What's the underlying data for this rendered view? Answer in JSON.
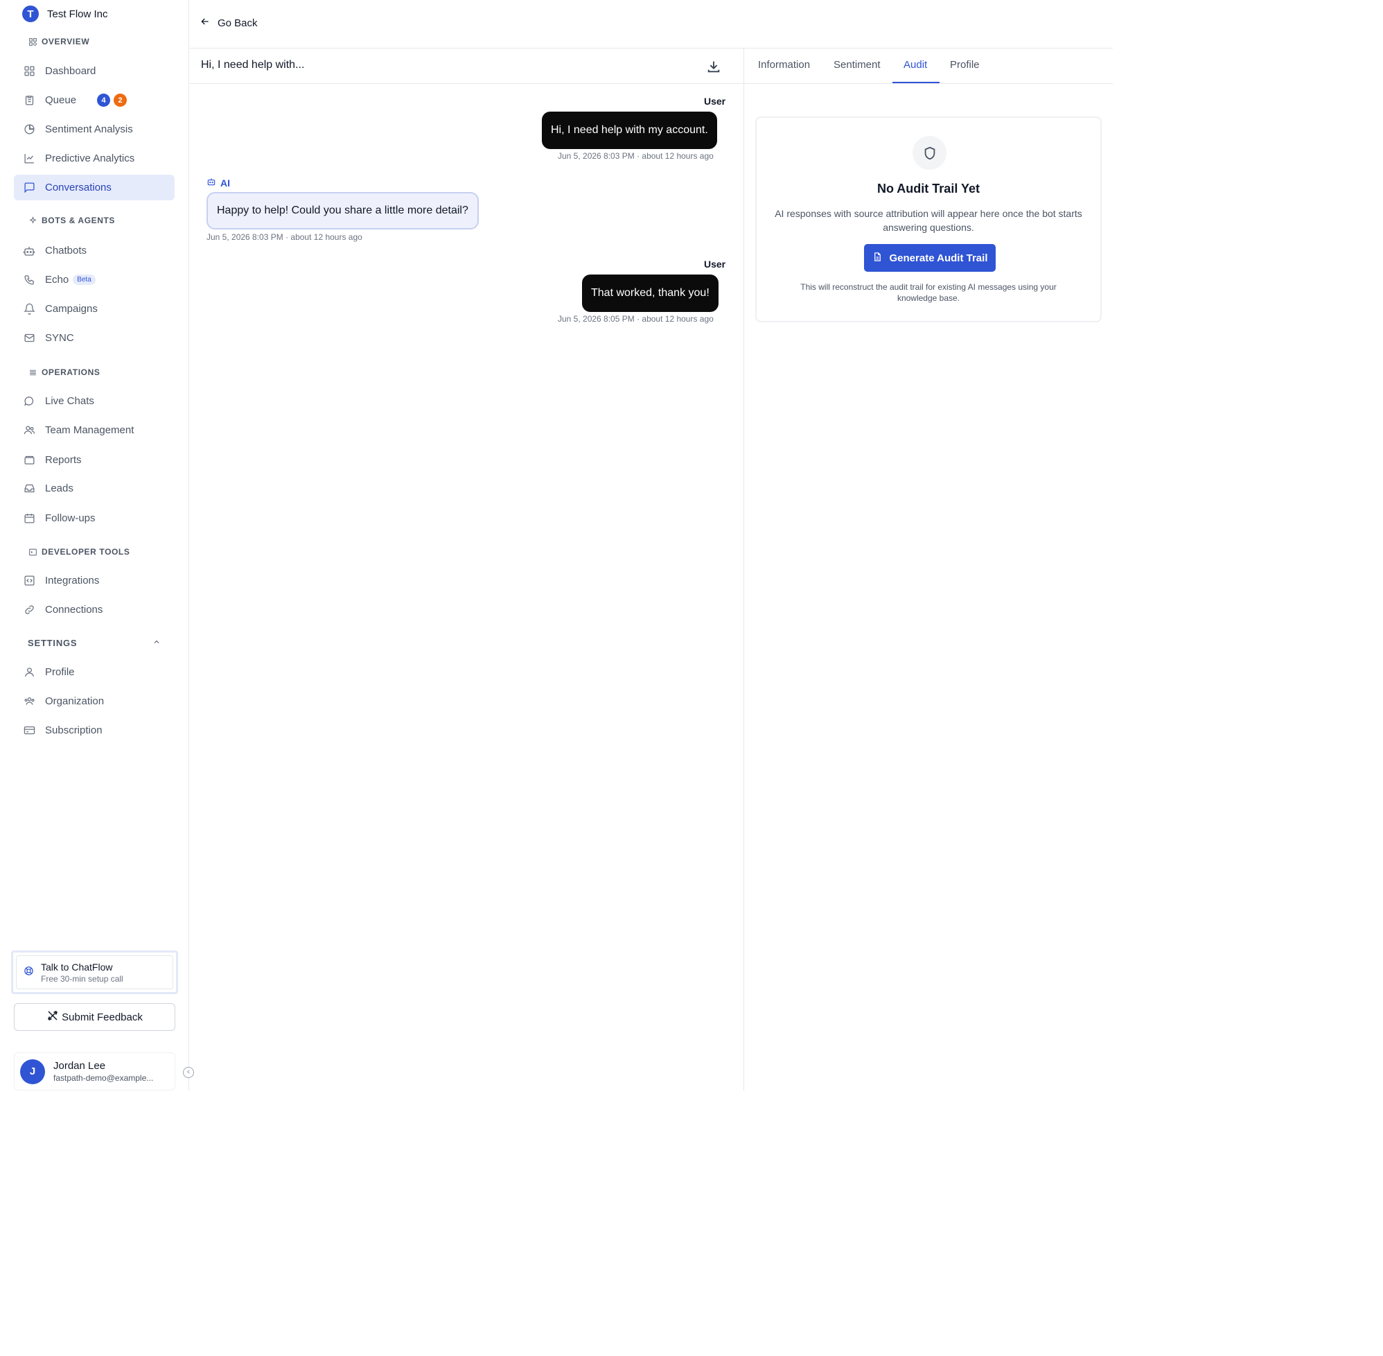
{
  "brand": {
    "name": "Test Flow Inc",
    "logo_letter": "T"
  },
  "sections": {
    "overview": "OVERVIEW",
    "bots": "BOTS & AGENTS",
    "operations": "OPERATIONS",
    "developer": "DEVELOPER TOOLS",
    "settings": "SETTINGS"
  },
  "nav": {
    "dashboard": "Dashboard",
    "queue": "Queue",
    "queue_badge_blue": "4",
    "queue_badge_orange": "2",
    "sentiment": "Sentiment Analysis",
    "predictive": "Predictive Analytics",
    "conversations": "Conversations",
    "chatbots": "Chatbots",
    "echo": "Echo",
    "echo_badge": "Beta",
    "campaigns": "Campaigns",
    "sync": "SYNC",
    "live_chats": "Live Chats",
    "team": "Team Management",
    "reports": "Reports",
    "leads": "Leads",
    "followups": "Follow-ups",
    "integrations": "Integrations",
    "connections": "Connections",
    "profile": "Profile",
    "organization": "Organization",
    "subscription": "Subscription"
  },
  "talk": {
    "title": "Talk to ChatFlow",
    "subtitle": "Free 30-min setup call"
  },
  "feedback": {
    "label": "Submit Feedback"
  },
  "user": {
    "initial": "J",
    "name": "Jordan Lee",
    "email": "fastpath-demo@example..."
  },
  "topbar": {
    "back_label": "Go Back"
  },
  "chat": {
    "title": "Hi, I need help with...",
    "messages": [
      {
        "sender": "User",
        "text": "Hi, I need help with my account.",
        "meta": "Jun 5, 2026 8:03 PM · about 12 hours ago"
      },
      {
        "sender": "AI",
        "text": "Happy to help! Could you share a little more detail?",
        "meta": "Jun 5, 2026 8:03 PM · about 12 hours ago"
      },
      {
        "sender": "User",
        "text": "That worked, thank you!",
        "meta": "Jun 5, 2026 8:05 PM · about 12 hours ago"
      }
    ]
  },
  "tabs": [
    "Information",
    "Sentiment",
    "Audit",
    "Profile"
  ],
  "audit": {
    "title": "No Audit Trail Yet",
    "description": "AI responses with source attribution will appear here once the bot starts answering questions.",
    "button": "Generate Audit Trail",
    "note": "This will reconstruct the audit trail for existing AI messages using your knowledge base."
  },
  "colors": {
    "accent": "#2f54d4",
    "badge_orange": "#ee6b12",
    "user_bubble": "#0b0b0c",
    "ai_bubble": "#eef1fb"
  }
}
